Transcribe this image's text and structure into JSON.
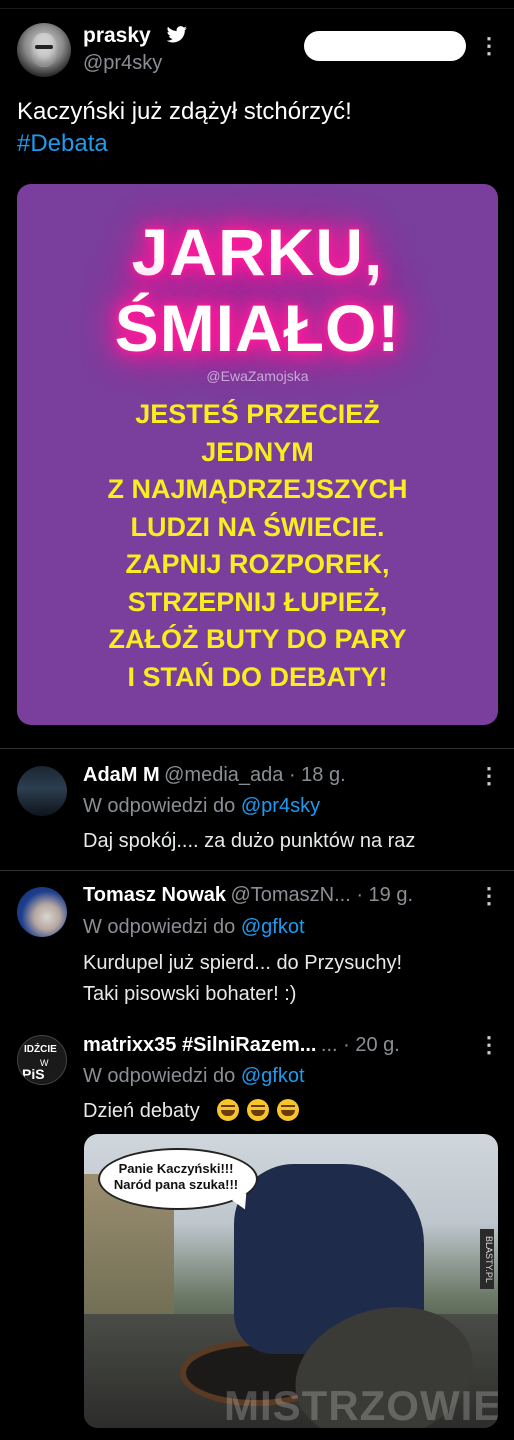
{
  "tweet": {
    "display_name": "prasky",
    "handle": "@pr4sky",
    "text_line1": "Kaczyński już zdążył stchórzyć!",
    "hashtag": "#Debata"
  },
  "meme": {
    "title_line1": "JARKU,",
    "title_line2": "ŚMIAŁO!",
    "credit": "@EwaZamojska",
    "body_lines": [
      "JESTEŚ PRZECIEŻ",
      "JEDNYM",
      "Z NAJMĄDRZEJSZYCH",
      "LUDZI NA ŚWIECIE.",
      "ZAPNIJ ROZPOREK,",
      "STRZEPNIJ ŁUPIEŻ,",
      "ZAŁÓŻ BUTY DO PARY",
      "I STAŃ DO DEBATY!"
    ],
    "colors": {
      "background": "#7a3f9c",
      "title": "#ffffff",
      "glow": "#ff1b9a",
      "body": "#f6ee1e"
    }
  },
  "replies": [
    {
      "name": "AdaM M",
      "meta": "@media_ada · 18 g.",
      "reply_prefix": "W odpowiedzi do ",
      "reply_to": "@pr4sky",
      "lines": [
        "Daj spokój.... za dużo punktów na raz"
      ]
    },
    {
      "name": "Tomasz Nowak",
      "meta": "@TomaszN... · 19 g.",
      "reply_prefix": "W odpowiedzi do ",
      "reply_to": "@gfkot",
      "lines": [
        "Kurdupel już spierd... do Przysuchy!",
        "Taki pisowski bohater! :)"
      ]
    },
    {
      "name": "matrixx35 #SilniRazem...",
      "meta": "... · 20 g.",
      "reply_prefix": "W odpowiedzi do ",
      "reply_to": "@gfkot",
      "lines": [
        "Dzień debaty"
      ],
      "emoji": [
        "rolling-on-floor-laughing",
        "rolling-on-floor-laughing",
        "rolling-on-floor-laughing"
      ],
      "avatar_text": [
        "IDŹCIE",
        "W",
        "PiS"
      ],
      "photo": {
        "speech_line1": "Panie Kaczyński!!!",
        "speech_line2": "Naród pana szuka!!!",
        "side_watermark": "BLASTY.PL",
        "site_watermark": "MISTRZOWIE.ORG"
      }
    }
  ],
  "colors": {
    "link": "#1d9bf0",
    "muted": "#8b8f94",
    "text": "#e7e9ea",
    "divider": "#2f3336"
  }
}
